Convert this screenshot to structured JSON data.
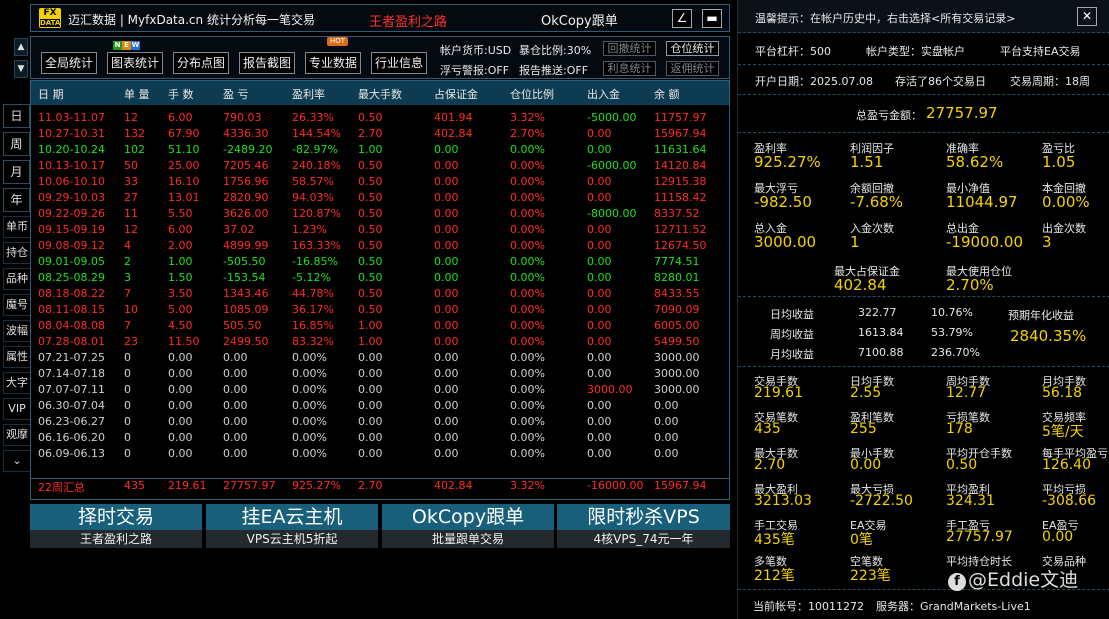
{
  "title": {
    "app": "迈汇数据 | MyfxData.cn  统计分析每一笔交易",
    "red_tag": "王者盈利之路",
    "okcopy": "OkCopy跟单",
    "logo_top": "FX",
    "logo_bottom": "DATA",
    "minimize": "∠",
    "restore": "▬"
  },
  "side_arrows": {
    "up": "▲",
    "down": "▼"
  },
  "left_nav": [
    "日",
    "周",
    "月",
    "年",
    "单币",
    "持仓",
    "品种",
    "魔号",
    "波幅",
    "属性",
    "大字",
    "VIP",
    "观摩",
    "⌄"
  ],
  "toolbar": {
    "buttons": [
      "全局统计",
      "图表统计",
      "分布点图",
      "报告截图",
      "专业数据",
      "行业信息"
    ],
    "new_badge": [
      "N",
      "E",
      "W"
    ],
    "hot_badge": "HOT",
    "account_currency": "帐户货币:USD",
    "exposure_ratio": "暴仓比例:30%",
    "float_alert": "浮亏警报:OFF",
    "report_push": "报告推送:OFF",
    "small_buttons": [
      "回撤统计",
      "仓位统计",
      "利息统计",
      "返佣统计"
    ]
  },
  "table": {
    "headers": [
      "日 期",
      "单 量",
      "手 数",
      "盈 亏",
      "盈利率",
      "最大手数",
      "占保证金",
      "仓位比例",
      "出入金",
      "余 额"
    ],
    "rows": [
      {
        "c": "red",
        "v": [
          "11.03-11.07",
          "12",
          "6.00",
          "790.03",
          "26.33%",
          "0.50",
          "401.94",
          "3.32%",
          "-5000.00",
          "11757.97"
        ],
        "dep": "green"
      },
      {
        "c": "red",
        "v": [
          "10.27-10.31",
          "132",
          "67.90",
          "4336.30",
          "144.54%",
          "2.70",
          "402.84",
          "2.70%",
          "0.00",
          "15967.94"
        ]
      },
      {
        "c": "green",
        "v": [
          "10.20-10.24",
          "102",
          "51.10",
          "-2489.20",
          "-82.97%",
          "1.00",
          "0.00",
          "0.00%",
          "0.00",
          "11631.64"
        ]
      },
      {
        "c": "red",
        "v": [
          "10.13-10.17",
          "50",
          "25.00",
          "7205.46",
          "240.18%",
          "0.50",
          "0.00",
          "0.00%",
          "-6000.00",
          "14120.84"
        ],
        "dep": "green"
      },
      {
        "c": "red",
        "v": [
          "10.06-10.10",
          "33",
          "16.10",
          "1756.96",
          "58.57%",
          "0.50",
          "0.00",
          "0.00%",
          "0.00",
          "12915.38"
        ]
      },
      {
        "c": "red",
        "v": [
          "09.29-10.03",
          "27",
          "13.01",
          "2820.90",
          "94.03%",
          "0.50",
          "0.00",
          "0.00%",
          "0.00",
          "11158.42"
        ]
      },
      {
        "c": "red",
        "v": [
          "09.22-09.26",
          "11",
          "5.50",
          "3626.00",
          "120.87%",
          "0.50",
          "0.00",
          "0.00%",
          "-8000.00",
          "8337.52"
        ],
        "dep": "green"
      },
      {
        "c": "red",
        "v": [
          "09.15-09.19",
          "12",
          "6.00",
          "37.02",
          "1.23%",
          "0.50",
          "0.00",
          "0.00%",
          "0.00",
          "12711.52"
        ]
      },
      {
        "c": "red",
        "v": [
          "09.08-09.12",
          "4",
          "2.00",
          "4899.99",
          "163.33%",
          "0.50",
          "0.00",
          "0.00%",
          "0.00",
          "12674.50"
        ]
      },
      {
        "c": "green",
        "v": [
          "09.01-09.05",
          "2",
          "1.00",
          "-505.50",
          "-16.85%",
          "0.50",
          "0.00",
          "0.00%",
          "0.00",
          "7774.51"
        ]
      },
      {
        "c": "green",
        "v": [
          "08.25-08.29",
          "3",
          "1.50",
          "-153.54",
          "-5.12%",
          "0.50",
          "0.00",
          "0.00%",
          "0.00",
          "8280.01"
        ]
      },
      {
        "c": "red",
        "v": [
          "08.18-08.22",
          "7",
          "3.50",
          "1343.46",
          "44.78%",
          "0.50",
          "0.00",
          "0.00%",
          "0.00",
          "8433.55"
        ]
      },
      {
        "c": "red",
        "v": [
          "08.11-08.15",
          "10",
          "5.00",
          "1085.09",
          "36.17%",
          "0.50",
          "0.00",
          "0.00%",
          "0.00",
          "7090.09"
        ]
      },
      {
        "c": "red",
        "v": [
          "08.04-08.08",
          "7",
          "4.50",
          "505.50",
          "16.85%",
          "1.00",
          "0.00",
          "0.00%",
          "0.00",
          "6005.00"
        ]
      },
      {
        "c": "red",
        "v": [
          "07.28-08.01",
          "23",
          "11.50",
          "2499.50",
          "83.32%",
          "1.00",
          "0.00",
          "0.00%",
          "0.00",
          "5499.50"
        ]
      },
      {
        "c": "gray",
        "v": [
          "07.21-07.25",
          "0",
          "0.00",
          "0.00",
          "0.00%",
          "0.00",
          "0.00",
          "0.00%",
          "0.00",
          "3000.00"
        ]
      },
      {
        "c": "gray",
        "v": [
          "07.14-07.18",
          "0",
          "0.00",
          "0.00",
          "0.00%",
          "0.00",
          "0.00",
          "0.00%",
          "0.00",
          "3000.00"
        ]
      },
      {
        "c": "gray",
        "v": [
          "07.07-07.11",
          "0",
          "0.00",
          "0.00",
          "0.00%",
          "0.00",
          "0.00",
          "0.00%",
          "3000.00",
          "3000.00"
        ],
        "dep": "red"
      },
      {
        "c": "gray",
        "v": [
          "06.30-07.04",
          "0",
          "0.00",
          "0.00",
          "0.00%",
          "0.00",
          "0.00",
          "0.00%",
          "0.00",
          "0.00"
        ]
      },
      {
        "c": "gray",
        "v": [
          "06.23-06.27",
          "0",
          "0.00",
          "0.00",
          "0.00%",
          "0.00",
          "0.00",
          "0.00%",
          "0.00",
          "0.00"
        ]
      },
      {
        "c": "gray",
        "v": [
          "06.16-06.20",
          "0",
          "0.00",
          "0.00",
          "0.00%",
          "0.00",
          "0.00",
          "0.00%",
          "0.00",
          "0.00"
        ]
      },
      {
        "c": "gray",
        "v": [
          "06.09-06.13",
          "0",
          "0.00",
          "0.00",
          "0.00%",
          "0.00",
          "0.00",
          "0.00%",
          "0.00",
          "0.00"
        ]
      }
    ],
    "total": [
      "22周汇总",
      "435",
      "219.61",
      "27757.97",
      "925.27%",
      "2.70",
      "402.84",
      "3.32%",
      "-16000.00",
      "15967.94"
    ]
  },
  "banners": [
    {
      "big": "择时交易",
      "small": "王者盈利之路"
    },
    {
      "big": "挂EA云主机",
      "small": "VPS云主机5折起"
    },
    {
      "big": "OkCopy跟单",
      "small": "批量跟单交易"
    },
    {
      "big": "限时秒杀VPS",
      "small": "4核VPS_74元一年"
    }
  ],
  "right": {
    "tip": "温馨提示：在帐户历史中，右击选择<所有交易记录>",
    "close": "✕",
    "leverage": "平台杠杆：500",
    "account_type": "帐户类型：实盘帐户",
    "ea_support": "平台支持EA交易",
    "open_date": "开户日期：2025.07.08",
    "trade_days": "存活了86个交易日",
    "trade_weeks": "交易周期：18周",
    "total_profit_label": "总盈亏金额：",
    "total_profit": "27757.97",
    "stats1": [
      {
        "l": "盈利率",
        "v": "925.27%"
      },
      {
        "l": "利润因子",
        "v": "1.51"
      },
      {
        "l": "准确率",
        "v": "58.62%"
      },
      {
        "l": "盈亏比",
        "v": "1.05"
      },
      {
        "l": "最大浮亏",
        "v": "-982.50"
      },
      {
        "l": "余额回撤",
        "v": "-7.68%"
      },
      {
        "l": "最小净值",
        "v": "11044.97"
      },
      {
        "l": "本金回撤",
        "v": "0.00%"
      },
      {
        "l": "总入金",
        "v": "3000.00"
      },
      {
        "l": "入金次数",
        "v": "1"
      },
      {
        "l": "总出金",
        "v": "-19000.00"
      },
      {
        "l": "出金次数",
        "v": "3"
      }
    ],
    "max_margin_label": "最大占保证金",
    "max_margin": "402.84",
    "max_position_label": "最大使用仓位",
    "max_position": "2.70%",
    "avg": [
      {
        "l": "日均收益",
        "a": "322.77",
        "p": "10.76%"
      },
      {
        "l": "周均收益",
        "a": "1613.84",
        "p": "53.79%"
      },
      {
        "l": "月均收益",
        "a": "7100.88",
        "p": "236.70%"
      }
    ],
    "annual_label": "预期年化收益",
    "annual": "2840.35%",
    "stats2": [
      {
        "l": "交易手数",
        "v": "219.61"
      },
      {
        "l": "日均手数",
        "v": "2.55"
      },
      {
        "l": "周均手数",
        "v": "12.77"
      },
      {
        "l": "月均手数",
        "v": "56.18"
      },
      {
        "l": "交易笔数",
        "v": "435"
      },
      {
        "l": "盈利笔数",
        "v": "255"
      },
      {
        "l": "亏损笔数",
        "v": "178"
      },
      {
        "l": "交易频率",
        "v": "5笔/天"
      },
      {
        "l": "最大手数",
        "v": "2.70"
      },
      {
        "l": "最小手数",
        "v": "0.00"
      },
      {
        "l": "平均开仓手数",
        "v": "0.50"
      },
      {
        "l": "每手平均盈亏",
        "v": "126.40"
      },
      {
        "l": "最大盈利",
        "v": "3213.03"
      },
      {
        "l": "最大亏损",
        "v": "-2722.50"
      },
      {
        "l": "平均盈利",
        "v": "324.31"
      },
      {
        "l": "平均亏损",
        "v": "-308.66"
      },
      {
        "l": "手工交易",
        "v": "435笔"
      },
      {
        "l": "EA交易",
        "v": "0笔"
      },
      {
        "l": "手工盈亏",
        "v": "27757.97"
      },
      {
        "l": "EA盈亏",
        "v": "0.00"
      },
      {
        "l": "多笔数",
        "v": "212笔"
      },
      {
        "l": "空笔数",
        "v": "223笔"
      },
      {
        "l": "平均持仓时长",
        "v": ""
      },
      {
        "l": "交易品种",
        "v": ""
      }
    ],
    "account": "当前帐号：10011272",
    "server": "服务器：GrandMarkets-Live1",
    "watermark": "@Eddie文迪"
  }
}
